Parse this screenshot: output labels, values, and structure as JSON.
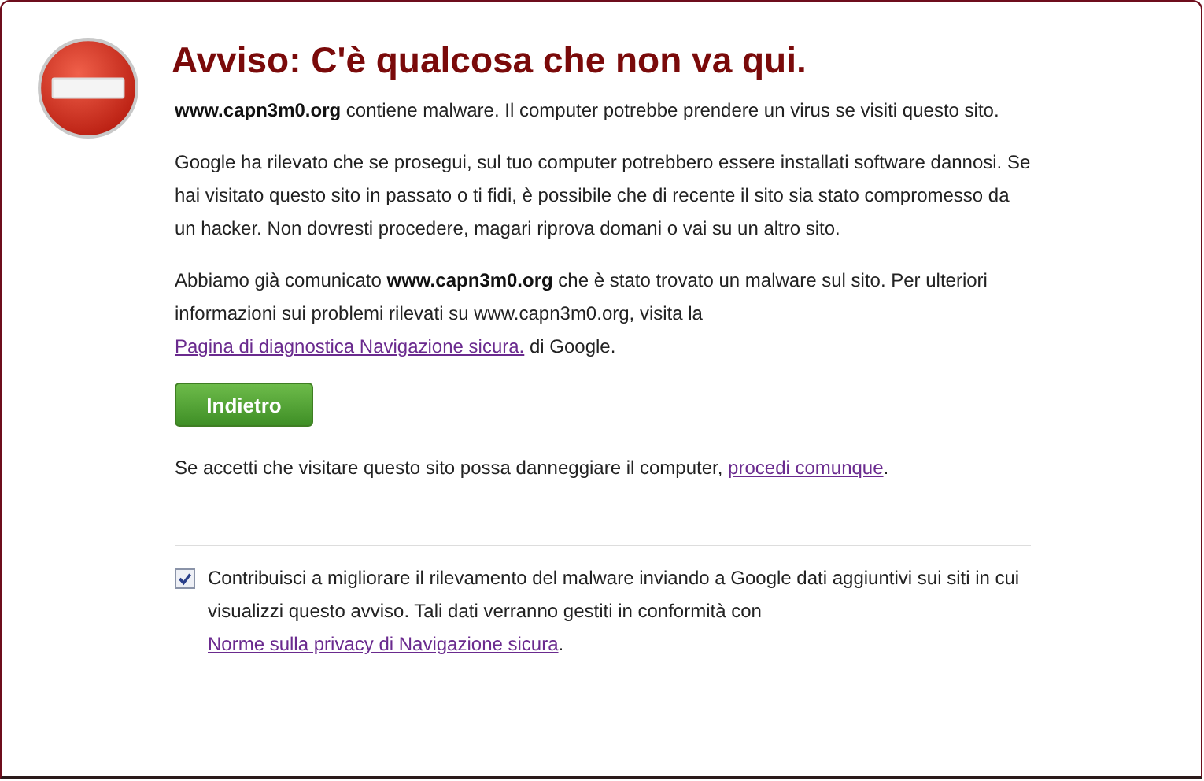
{
  "title": "Avviso: C'è qualcosa che non va qui.",
  "paragraphs": [
    [
      {
        "kind": "text",
        "text": "**www.capn3m0.org** contiene malware. Il computer potrebbe prendere un virus se visiti questo sito."
      }
    ],
    [
      {
        "kind": "text",
        "text": "Google ha rilevato che se prosegui, sul tuo computer potrebbero essere installati software dannosi. Se hai visitato questo sito in passato o ti fidi, è possibile che di recente il sito sia stato compromesso da un hacker. Non dovresti procedere, magari riprova domani o vai su un altro sito."
      }
    ],
    [
      {
        "kind": "text",
        "text": "Abbiamo già comunicato **www.capn3m0.org** che è stato trovato un malware sul sito. Per ulteriori informazioni sui problemi rilevati su www.capn3m0.org, visita la "
      },
      {
        "kind": "link",
        "text": "Pagina di diagnostica Navigazione sicura."
      },
      {
        "kind": "text",
        "text": " di Google."
      }
    ]
  ],
  "back_button": "Indietro",
  "proceed": [
    {
      "kind": "text",
      "text": "Se accetti che visitare questo sito possa danneggiare il computer, "
    },
    {
      "kind": "link",
      "text": "procedi comunque"
    },
    {
      "kind": "text",
      "text": "."
    }
  ],
  "report": {
    "checked": true,
    "parts": [
      {
        "kind": "text",
        "text": "Contribuisci a migliorare il rilevamento del malware inviando a Google dati aggiuntivi sui siti in cui visualizzi questo avviso. Tali dati verranno gestiti in conformità con "
      },
      {
        "kind": "link",
        "text": "Norme sulla privacy di Navigazione sicura"
      },
      {
        "kind": "text",
        "text": "."
      }
    ]
  }
}
